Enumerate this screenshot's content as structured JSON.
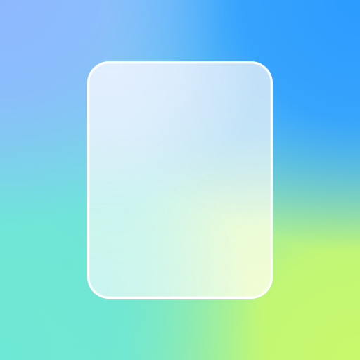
{
  "scene": {
    "background_colors": {
      "top_left": "#8fb7ff",
      "top_right": "#2b9bff",
      "bottom_left": "#6de8d6",
      "bottom_right": "#c8f96c"
    },
    "card_colors": {
      "border": "#ffffff",
      "fill_top": "#dbeafe",
      "fill_bottom": "#e8fbdc"
    }
  }
}
